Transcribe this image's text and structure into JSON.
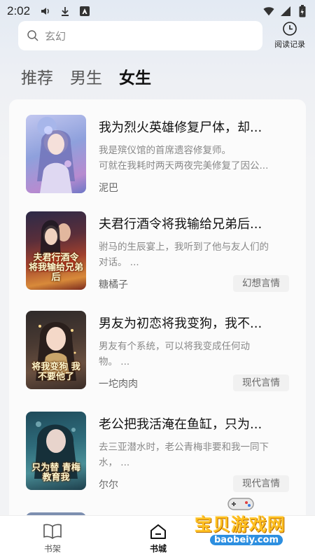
{
  "status_bar": {
    "time": "2:02"
  },
  "search": {
    "text": "玄幻",
    "history_label": "阅读记录"
  },
  "tabs": [
    {
      "label": "推荐",
      "active": false
    },
    {
      "label": "男生",
      "active": false
    },
    {
      "label": "女生",
      "active": true
    }
  ],
  "books": [
    {
      "title": "我为烈火英雄修复尸体，却...",
      "desc_line1": "我是殡仪馆的首席遗容修复师。",
      "desc_line2": "可就在我耗时两天两夜完美修复了因公...",
      "author": "泥巴",
      "tag": "",
      "cover_text": ""
    },
    {
      "title": "夫君行酒令将我输给兄弟后...",
      "desc_line1": "驸马的生辰宴上，我听到了他与友人们的",
      "desc_line2": "对话。 ...",
      "author": "糖橘子",
      "tag": "幻想言情",
      "cover_text": "夫君行酒令 将我输给兄弟后"
    },
    {
      "title": "男友为初恋将我变狗，我不...",
      "desc_line1": "男友有个系统，可以将我变成任何动",
      "desc_line2": "物。 ...",
      "author": "一坨肉肉",
      "tag": "现代言情",
      "cover_text": "将我变狗 我不要他了"
    },
    {
      "title": "老公把我活淹在鱼缸，只为...",
      "desc_line1": "去三亚潜水时，老公青梅非要和我一同下",
      "desc_line2": "水， ...",
      "author": "尔尔",
      "tag": "现代言情",
      "cover_text": "只为替 青梅教育我"
    }
  ],
  "bottom_nav": [
    {
      "label": "书架",
      "icon": "book-open-icon",
      "active": false
    },
    {
      "label": "书城",
      "icon": "home-icon",
      "active": true
    }
  ],
  "watermark": {
    "brand": "宝贝游戏网",
    "url": "baobeiy.com"
  },
  "colors": {
    "accent_text": "#111111",
    "tag_bg": "#f1f1f1",
    "watermark_yellow": "#ffbf1f"
  }
}
